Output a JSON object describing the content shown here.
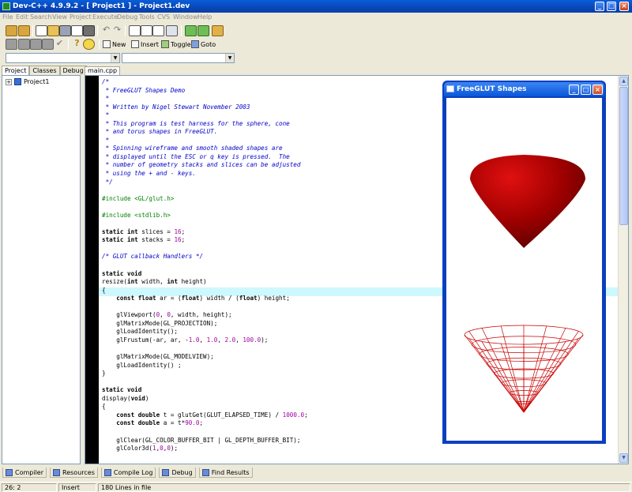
{
  "window": {
    "title": "Dev-C++ 4.9.9.2  - [ Project1 ] - Project1.dev"
  },
  "menu": [
    "File",
    "Edit",
    "Search",
    "View",
    "Project",
    "Execute",
    "Debug",
    "Tools",
    "CVS",
    "Window",
    "Help"
  ],
  "toolbar": {
    "new": "New",
    "insert": "Insert",
    "toggle": "Toggle",
    "goto": "Goto"
  },
  "left_panel": {
    "tabs": [
      "Project",
      "Classes",
      "Debug"
    ],
    "tree": {
      "root": "Project1"
    }
  },
  "editor": {
    "tab": "main.cpp",
    "lines": [
      "/*",
      " * FreeGLUT Shapes Demo",
      " *",
      " * Written by Nigel Stewart November 2003",
      " *",
      " * This program is test harness for the sphere, cone",
      " * and torus shapes in FreeGLUT.",
      " *",
      " * Spinning wireframe and smooth shaded shapes are",
      " * displayed until the ESC or q key is pressed.  The",
      " * number of geometry stacks and slices can be adjusted",
      " * using the + and - keys.",
      " */",
      "",
      "#include <GL/glut.h>",
      "",
      "#include <stdlib.h>",
      "",
      "static int slices = 16;",
      "static int stacks = 16;",
      "",
      "/* GLUT callback Handlers */",
      "",
      "static void",
      "resize(int width, int height)",
      "{",
      "    const float ar = (float) width / (float) height;",
      "",
      "    glViewport(0, 0, width, height);",
      "    glMatrixMode(GL_PROJECTION);",
      "    glLoadIdentity();",
      "    glFrustum(-ar, ar, -1.0, 1.0, 2.0, 100.0);",
      "",
      "    glMatrixMode(GL_MODELVIEW);",
      "    glLoadIdentity() ;",
      "}",
      "",
      "static void",
      "display(void)",
      "{",
      "    const double t = glutGet(GLUT_ELAPSED_TIME) / 1000.0;",
      "    const double a = t*90.0;",
      "",
      "    glClear(GL_COLOR_BUFFER_BIT | GL_DEPTH_BUFFER_BIT);",
      "    glColor3d(1,0,0);"
    ]
  },
  "glut_window": {
    "title": "FreeGLUT Shapes",
    "shape_color": "#b00000"
  },
  "bottom_tabs": [
    "Compiler",
    "Resources",
    "Compile Log",
    "Debug",
    "Find Results"
  ],
  "status": {
    "position": "26: 2",
    "mode": "Insert",
    "info": "180 Lines in file"
  }
}
